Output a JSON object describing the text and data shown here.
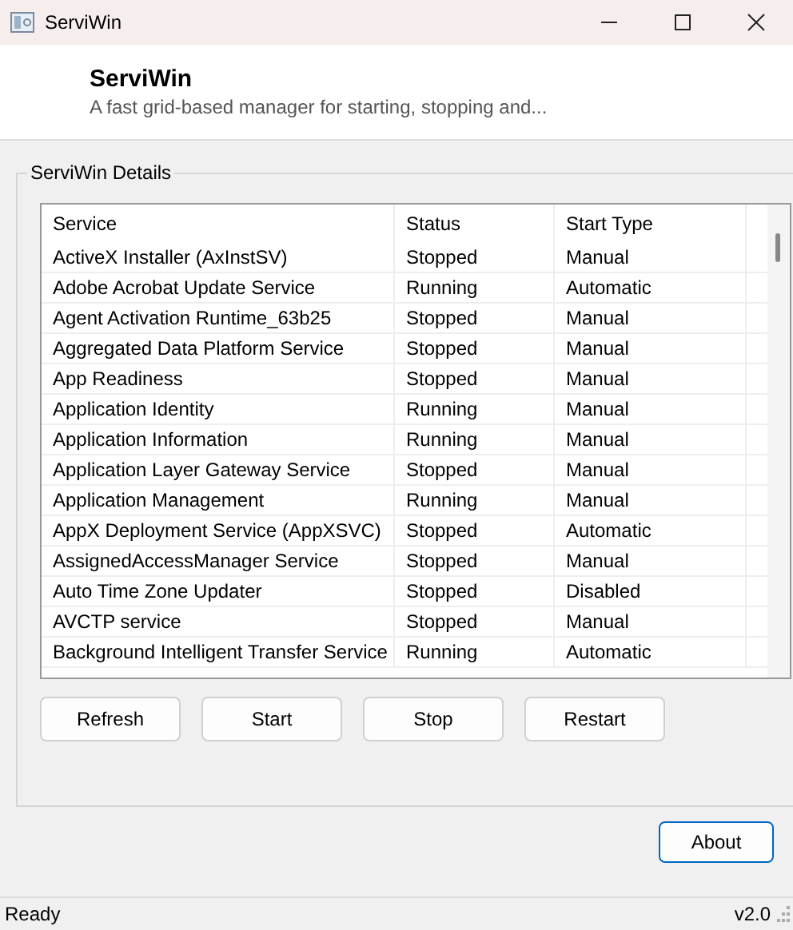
{
  "window": {
    "title": "ServiWin"
  },
  "header": {
    "title": "ServiWin",
    "subtitle": "A fast grid-based manager for starting, stopping and..."
  },
  "group": {
    "title": "ServiWin Details"
  },
  "table": {
    "columns": [
      "Service",
      "Status",
      "Start Type"
    ],
    "rows": [
      [
        "ActiveX Installer (AxInstSV)",
        "Stopped",
        "Manual"
      ],
      [
        "Adobe Acrobat Update Service",
        "Running",
        "Automatic"
      ],
      [
        "Agent Activation Runtime_63b25",
        "Stopped",
        "Manual"
      ],
      [
        "Aggregated Data Platform Service",
        "Stopped",
        "Manual"
      ],
      [
        "App Readiness",
        "Stopped",
        "Manual"
      ],
      [
        "Application Identity",
        "Running",
        "Manual"
      ],
      [
        "Application Information",
        "Running",
        "Manual"
      ],
      [
        "Application Layer Gateway Service",
        "Stopped",
        "Manual"
      ],
      [
        "Application Management",
        "Running",
        "Manual"
      ],
      [
        "AppX Deployment Service (AppXSVC)",
        "Stopped",
        "Automatic"
      ],
      [
        "AssignedAccessManager Service",
        "Stopped",
        "Manual"
      ],
      [
        "Auto Time Zone Updater",
        "Stopped",
        "Disabled"
      ],
      [
        "AVCTP service",
        "Stopped",
        "Manual"
      ],
      [
        "Background Intelligent Transfer Service",
        "Running",
        "Automatic"
      ]
    ]
  },
  "actions": [
    "Refresh",
    "Start",
    "Stop",
    "Restart"
  ],
  "about_button": "About",
  "status_bar": {
    "message": "Ready",
    "version": "v2.0"
  }
}
